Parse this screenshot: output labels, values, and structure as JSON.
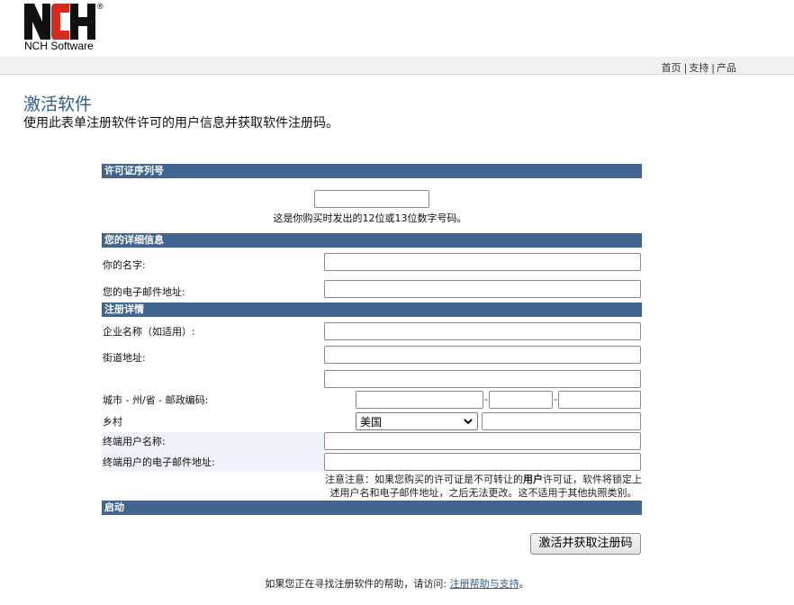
{
  "logo": {
    "mark": "NCH",
    "registered": "®",
    "subtitle": "NCH Software"
  },
  "topnav": {
    "home": "首页",
    "support": "支持",
    "products": "产品",
    "sep": "|"
  },
  "page": {
    "title": "激活软件",
    "subtitle": "使用此表单注册软件许可的用户信息并获取软件注册码。"
  },
  "sections": {
    "license": "许可证序列号",
    "details": "您的详细信息",
    "registration": "注册详情",
    "activate": "启动"
  },
  "license": {
    "serial_value": "",
    "hint": "这是你购买时发出的12位或13位数字号码。"
  },
  "details": {
    "name_label": "你的名字:",
    "email_label": "您的电子邮件地址:",
    "name_value": "",
    "email_value": ""
  },
  "registration": {
    "company_label": "企业名称（如适用）:",
    "street_label": "街道地址:",
    "city_label": "城市 - 州/省 - 邮政编码:",
    "country_label": "乡村",
    "country_selected": "美国",
    "enduser_name_label": "终端用户名称:",
    "enduser_email_label": "终端用户的电子邮件地址:",
    "dash": "-",
    "note_1": "注意注意：如果您购买的许可证是不可转让的",
    "note_bold": "用户",
    "note_2": "许可证，软件将锁定上述用户名和电子邮件地址，之后无法更改。这不适用于其他执照类别。"
  },
  "activate": {
    "button_label": "激活并获取注册码"
  },
  "footer": {
    "text": "如果您正在寻找注册软件的帮助，请访问:",
    "link": "注册帮助与支持",
    "end": "。"
  }
}
